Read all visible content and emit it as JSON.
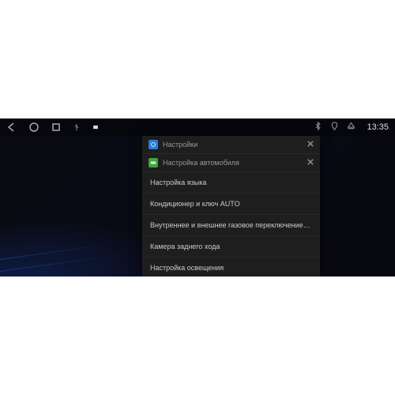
{
  "statusbar": {
    "clock": "13:35"
  },
  "dropdown": {
    "header1": "Настройки",
    "header2": "Настройка автомобиля",
    "items": [
      "Настройка языка",
      "Кондиционер и ключ AUTO",
      "Внутреннее и внешнее газовое переключение и автомат",
      "Камера заднего хода",
      "Настройка освещения"
    ]
  }
}
